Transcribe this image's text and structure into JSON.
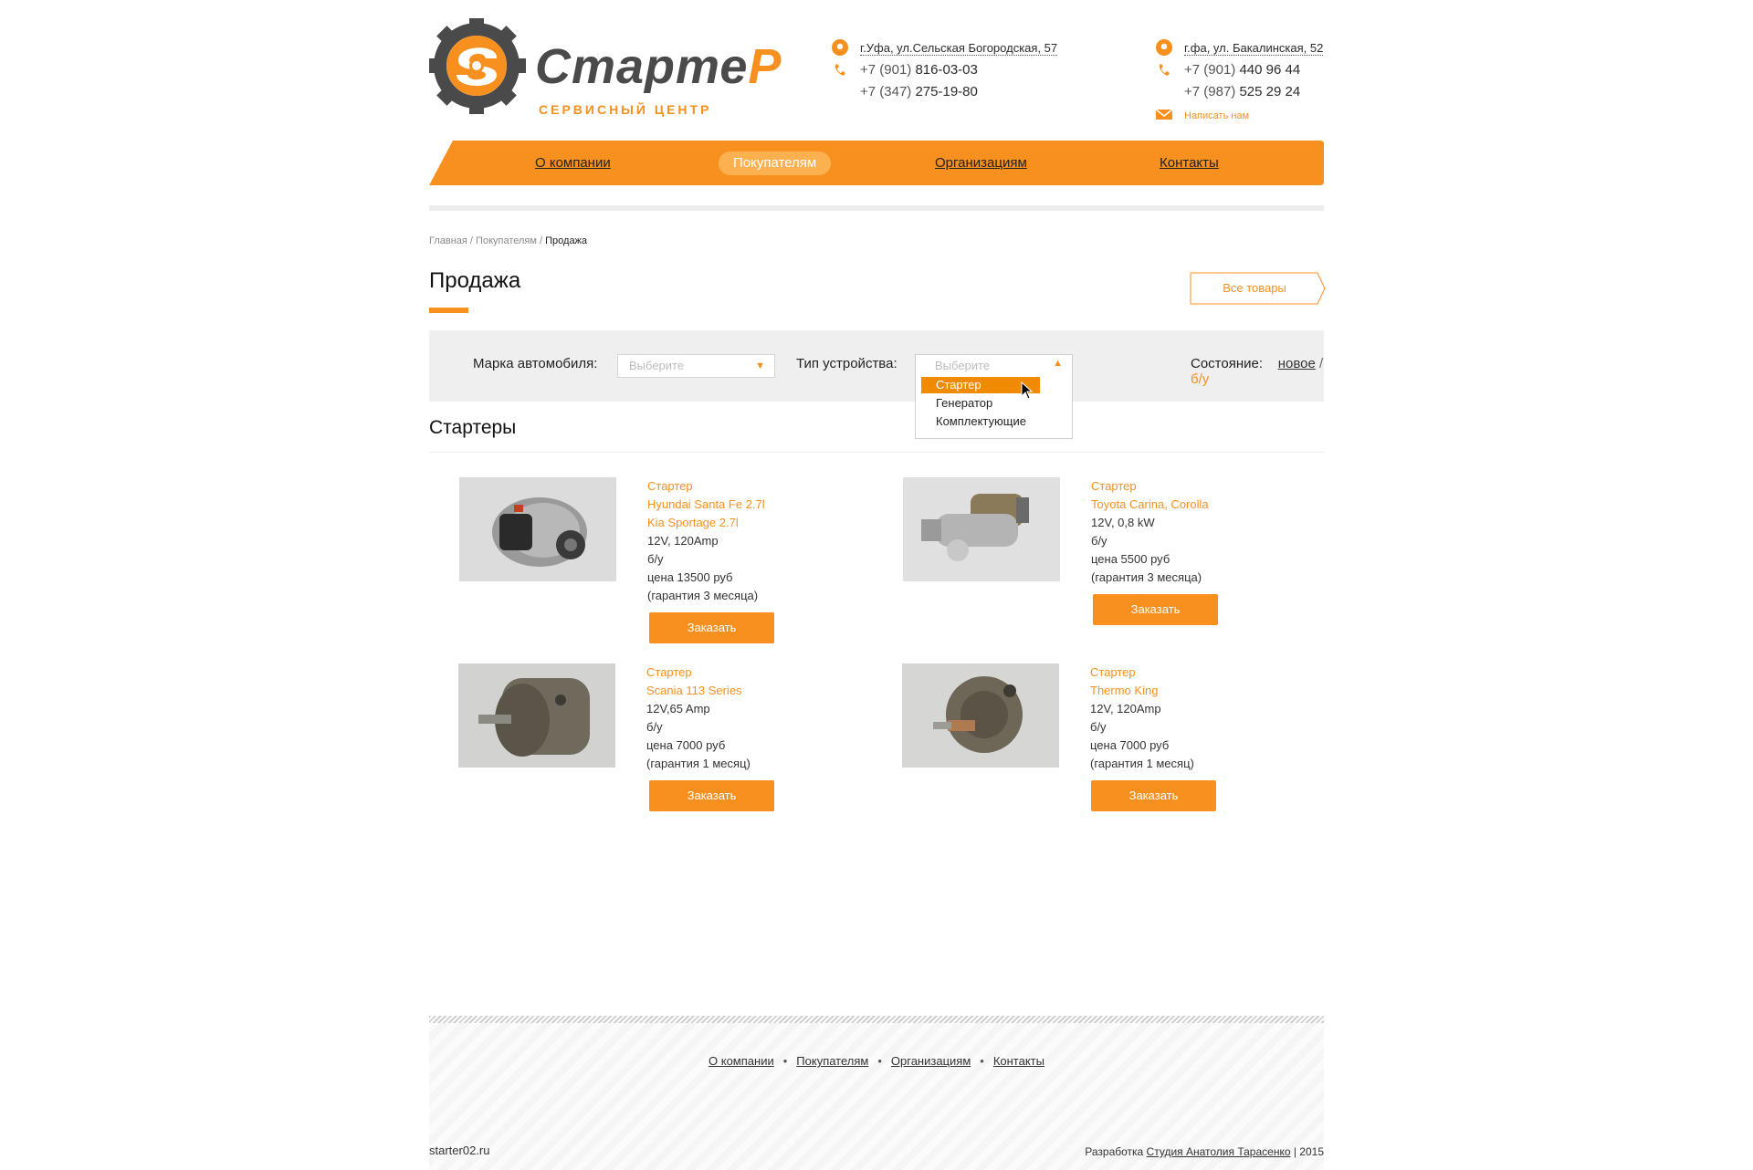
{
  "brand": {
    "name_main": "Старте",
    "name_accent": "Р",
    "subtitle": "СЕРВИСНЫЙ ЦЕНТР"
  },
  "contacts": [
    {
      "address": "г.Уфа, ул.Сельская Богородская, 57",
      "phones": [
        {
          "prefix": "+7 (901)",
          "number": "816-03-03"
        },
        {
          "prefix": "+7 (347)",
          "number": "275-19-80"
        }
      ]
    },
    {
      "address": "г.фа, ул. Бакалинская, 52",
      "phones": [
        {
          "prefix": "+7 (901)",
          "number": "440 96 44"
        },
        {
          "prefix": "+7 (987)",
          "number": "525 29 24"
        }
      ],
      "mail_label": "Написать нам"
    }
  ],
  "nav": [
    "О компании",
    "Покупателям",
    "Организациям",
    "Контакты"
  ],
  "nav_active": "Покупателям",
  "breadcrumbs": {
    "home": "Главная",
    "section": "Покупателям",
    "current": "Продажа",
    "sep": " / "
  },
  "page_title": "Продажа",
  "all_goods_label": "Все товары",
  "filter": {
    "brand_label": "Марка автомобиля:",
    "brand_placeholder": "Выберите",
    "type_label": "Тип устройства:",
    "type_placeholder": "Выберите",
    "type_options": [
      "Стартер",
      "Генератор",
      "Комплектующие"
    ],
    "type_highlighted": "Стартер",
    "state_label": "Состояние:",
    "state_new": "новое",
    "state_sep": "/",
    "state_used": "б/у"
  },
  "section_title": "Стартеры",
  "products": [
    {
      "kind": "Стартер",
      "model": [
        "Hyundai Santa Fe 2.7l",
        "Kia Sportage 2.7l"
      ],
      "spec": "12V, 120Amp",
      "condition": "б/у",
      "price": "цена 13500 руб",
      "warranty": "(гарантия 3 месяца)",
      "button": "Заказать"
    },
    {
      "kind": "Стартер",
      "model": [
        "Toyota Carina, Corolla"
      ],
      "spec": "12V, 0,8 kW",
      "condition": "б/у",
      "price": "цена 5500 руб",
      "warranty": "(гарантия 3 месяца)",
      "button": "Заказать"
    },
    {
      "kind": "Стартер",
      "model": [
        "Scania 113 Series"
      ],
      "spec": "12V,65 Amp",
      "condition": "б/у",
      "price": "цена 7000 руб",
      "warranty": "(гарантия 1 месяц)",
      "button": "Заказать"
    },
    {
      "kind": "Стартер",
      "model": [
        "Thermo King"
      ],
      "spec": "12V, 120Amp",
      "condition": "б/у",
      "price": "цена 7000 руб",
      "warranty": "(гарантия 1 месяц)",
      "button": "Заказать"
    }
  ],
  "footer": {
    "links": [
      "О компании",
      "Покупателям",
      "Организациям",
      "Контакты"
    ],
    "site": "starter02.ru",
    "dev_prefix": "Разработка ",
    "dev_name": "Студия Анатолия Тарасенко",
    "dev_suffix": " | 2015"
  },
  "colors": {
    "accent": "#f7901e",
    "nav_active": "#fbb14f",
    "dropdown_selected": "#f08a00",
    "filter_bg": "#efefef"
  }
}
